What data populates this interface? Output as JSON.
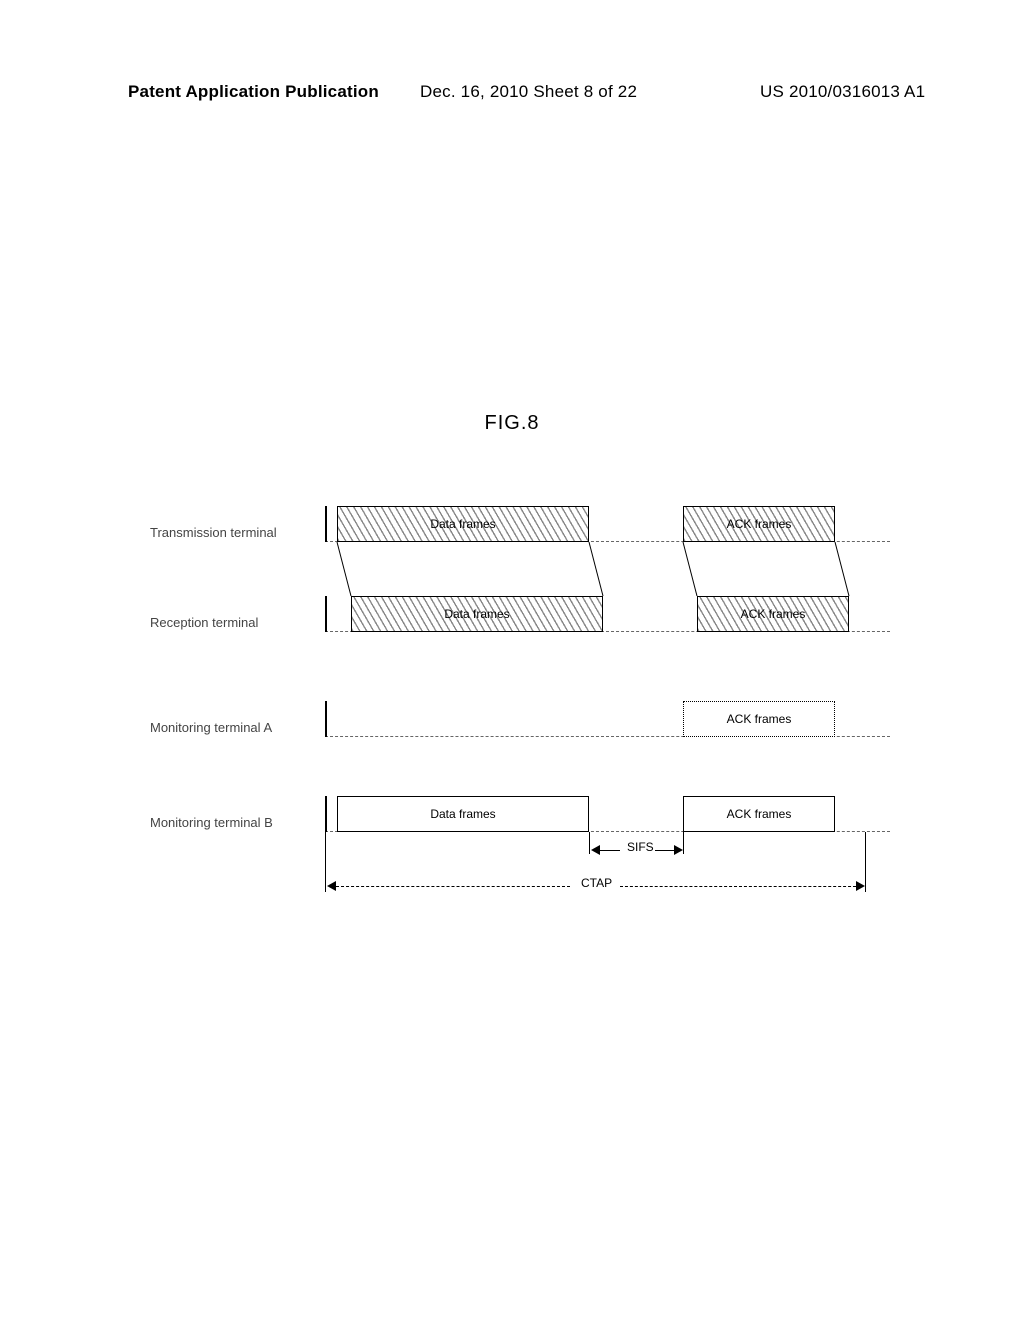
{
  "header": {
    "left": "Patent Application Publication",
    "mid": "Dec. 16, 2010  Sheet 8 of 22",
    "right": "US 2010/0316013 A1"
  },
  "figure_label": "FIG.8",
  "rows": {
    "tx": {
      "label": "Transmission terminal",
      "data": "Data frames",
      "ack": "ACK frames"
    },
    "rx": {
      "label": "Reception terminal",
      "data": "Data frames",
      "ack": "ACK frames"
    },
    "monA": {
      "label": "Monitoring terminal A",
      "ack": "ACK frames"
    },
    "monB": {
      "label": "Monitoring terminal B",
      "data": "Data frames",
      "ack": "ACK frames"
    }
  },
  "dims": {
    "sifs": "SIFS",
    "ctap": "CTAP"
  }
}
